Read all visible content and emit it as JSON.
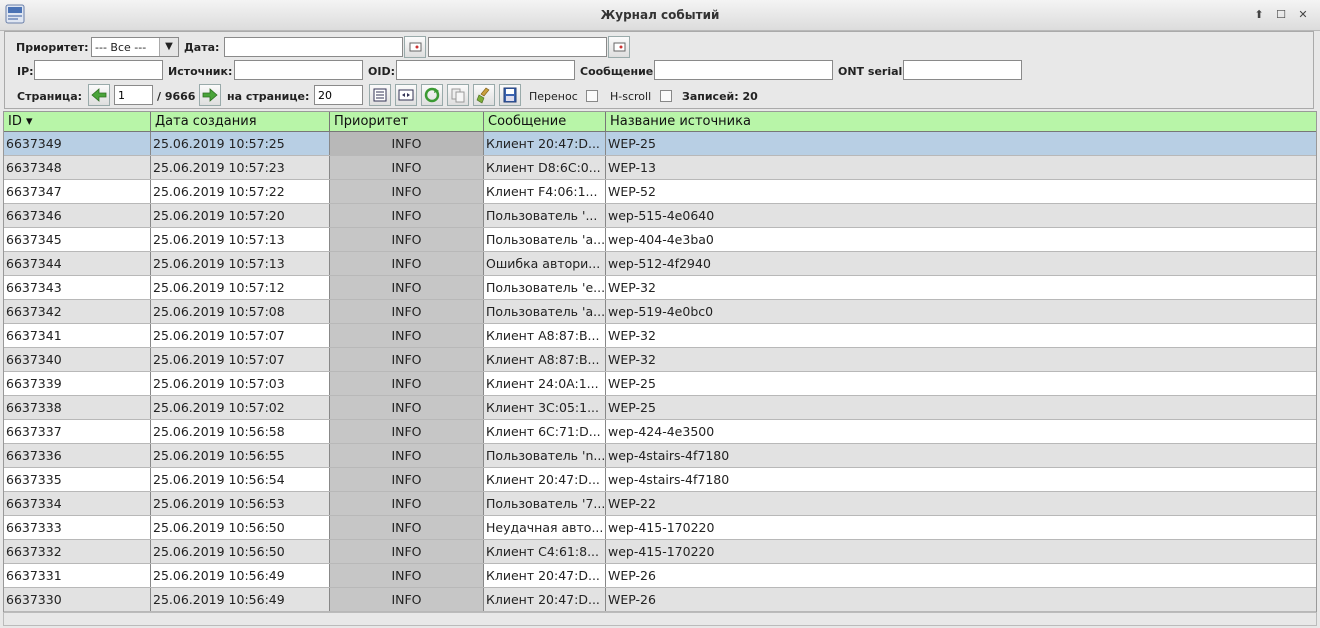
{
  "window": {
    "title": "Журнал событий"
  },
  "filters": {
    "priority_label": "Приоритет:",
    "priority_value": "--- Все ---",
    "date_label": "Дата:",
    "date_from": "",
    "date_to": "",
    "ip_label": "IP:",
    "ip_value": "",
    "source_label": "Источник:",
    "source_value": "",
    "oid_label": "OID:",
    "oid_value": "",
    "message_label": "Сообщение",
    "message_value": "",
    "ont_label": "ONT serial:",
    "ont_value": "",
    "page_label": "Страница:",
    "page_value": "1",
    "page_total": "/ 9666",
    "per_page_label": "на странице:",
    "per_page_value": "20",
    "wrap_label": "Перенос",
    "hscroll_label": "H-scroll",
    "records_label": "Записей: 20"
  },
  "table": {
    "columns": [
      "ID ▾",
      "Дата создания",
      "Приоритет",
      "Сообщение",
      "Название источника"
    ],
    "rows": [
      [
        "6637349",
        "25.06.2019 10:57:25",
        "INFO",
        "Клиент 20:47:D...",
        "WEP-25"
      ],
      [
        "6637348",
        "25.06.2019 10:57:23",
        "INFO",
        "Клиент D8:6C:0...",
        "WEP-13"
      ],
      [
        "6637347",
        "25.06.2019 10:57:22",
        "INFO",
        "Клиент F4:06:1...",
        "WEP-52"
      ],
      [
        "6637346",
        "25.06.2019 10:57:20",
        "INFO",
        "Пользователь '...",
        "wep-515-4e0640"
      ],
      [
        "6637345",
        "25.06.2019 10:57:13",
        "INFO",
        "Пользователь 'a...",
        "wep-404-4e3ba0"
      ],
      [
        "6637344",
        "25.06.2019 10:57:13",
        "INFO",
        "Ошибка автори...",
        "wep-512-4f2940"
      ],
      [
        "6637343",
        "25.06.2019 10:57:12",
        "INFO",
        "Пользователь 'e...",
        "WEP-32"
      ],
      [
        "6637342",
        "25.06.2019 10:57:08",
        "INFO",
        "Пользователь 'a...",
        "wep-519-4e0bc0"
      ],
      [
        "6637341",
        "25.06.2019 10:57:07",
        "INFO",
        "Клиент A8:87:B...",
        "WEP-32"
      ],
      [
        "6637340",
        "25.06.2019 10:57:07",
        "INFO",
        "Клиент A8:87:B...",
        "WEP-32"
      ],
      [
        "6637339",
        "25.06.2019 10:57:03",
        "INFO",
        "Клиент 24:0A:1...",
        "WEP-25"
      ],
      [
        "6637338",
        "25.06.2019 10:57:02",
        "INFO",
        "Клиент 3C:05:1...",
        "WEP-25"
      ],
      [
        "6637337",
        "25.06.2019 10:56:58",
        "INFO",
        "Клиент 6C:71:D...",
        "wep-424-4e3500"
      ],
      [
        "6637336",
        "25.06.2019 10:56:55",
        "INFO",
        "Пользователь 'n...",
        "wep-4stairs-4f7180"
      ],
      [
        "6637335",
        "25.06.2019 10:56:54",
        "INFO",
        "Клиент 20:47:D...",
        "wep-4stairs-4f7180"
      ],
      [
        "6637334",
        "25.06.2019 10:56:53",
        "INFO",
        "Пользователь '7...",
        "WEP-22"
      ],
      [
        "6637333",
        "25.06.2019 10:56:50",
        "INFO",
        "Неудачная авто...",
        "wep-415-170220"
      ],
      [
        "6637332",
        "25.06.2019 10:56:50",
        "INFO",
        "Клиент C4:61:8...",
        "wep-415-170220"
      ],
      [
        "6637331",
        "25.06.2019 10:56:49",
        "INFO",
        "Клиент 20:47:D...",
        "WEP-26"
      ],
      [
        "6637330",
        "25.06.2019 10:56:49",
        "INFO",
        "Клиент 20:47:D...",
        "WEP-26"
      ]
    ]
  },
  "colors": {
    "header_bg": "#b8f5a8",
    "selected_row": "#b8cfe4",
    "alt_row": "#e2e2e2",
    "priority_cell": "#c6c6c6"
  }
}
